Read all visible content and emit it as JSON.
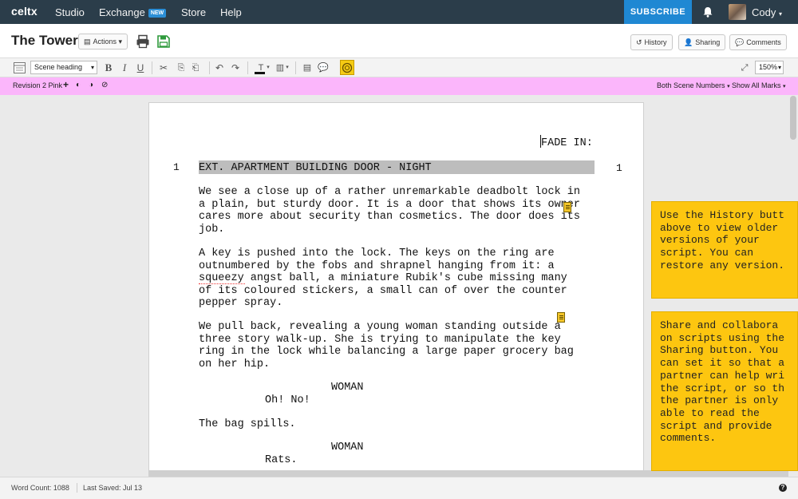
{
  "topnav": {
    "logo": "celtx",
    "links": [
      "Studio",
      "Exchange",
      "Store",
      "Help"
    ],
    "exchange_badge": "NEW",
    "subscribe": "SUBSCRIBE",
    "username": "Cody"
  },
  "titlebar": {
    "title": "The Tower",
    "actions": "Actions",
    "history": "History",
    "sharing": "Sharing",
    "comments": "Comments"
  },
  "toolbar": {
    "element_type": "Scene heading",
    "zoom": "150%"
  },
  "revision": {
    "label": "Revision 2 Pink",
    "scene_numbers": "Both Scene Numbers",
    "marks": "Show All Marks",
    "color": "#fbb6fb"
  },
  "script": {
    "transition": "FADE IN:",
    "scene_number": "1",
    "scene_heading": "EXT. APARTMENT BUILDING DOOR - NIGHT",
    "action1": [
      "We see a close up of a rather unremarkable deadbolt lock in",
      "a plain, but sturdy door. It is a door that shows its owner",
      "cares more about security than cosmetics. The door does its",
      "job."
    ],
    "action2": [
      "A key is pushed into the lock. The keys on the ring are",
      "outnumbered by the fobs and shrapnel hanging from it: a",
      "squeezy angst ball, a miniature Rubik's cube missing many",
      "of its coloured stickers, a small can of over the counter",
      "pepper spray."
    ],
    "action3": [
      "We pull back, revealing a young woman standing outside a",
      "three story walk-up. She is trying to manipulate the key",
      "ring in the lock while balancing a large paper grocery bag",
      "on her hip."
    ],
    "character1": "WOMAN",
    "dialogue1": "Oh! No!",
    "action4": "The bag spills.",
    "character2": "WOMAN",
    "dialogue2": "Rats."
  },
  "tips": [
    [
      "Use the History butt",
      "above to view older",
      "versions of your",
      "script. You can",
      "restore any version."
    ],
    [
      "Share and collabora",
      "on scripts using the",
      "Sharing button. You",
      "can set it so that a",
      "partner can help wri",
      "the script, or so th",
      "the partner is only",
      "able to read the",
      "script and provide",
      "comments."
    ]
  ],
  "status": {
    "word_count": "Word Count: 1088",
    "last_saved": "Last Saved: Jul 13"
  }
}
